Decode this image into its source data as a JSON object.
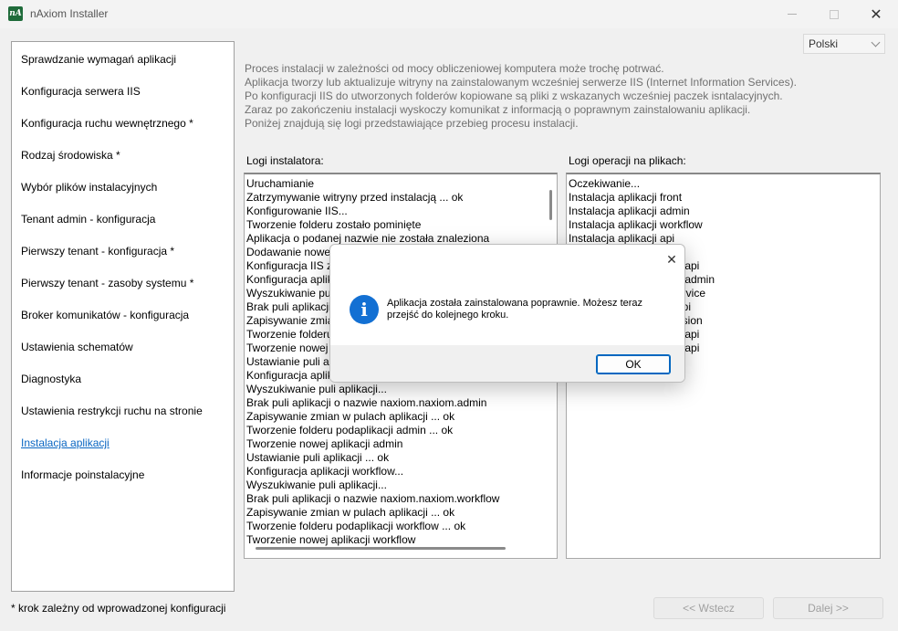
{
  "window": {
    "title": "nAxiom Installer",
    "icon_text": "nA",
    "close_glyph": "✕"
  },
  "sidebar": {
    "items": [
      {
        "label": "Sprawdzanie wymagań aplikacji"
      },
      {
        "label": "Konfiguracja serwera IIS"
      },
      {
        "label": "Konfiguracja ruchu wewnętrznego *"
      },
      {
        "label": "Rodzaj środowiska *"
      },
      {
        "label": "Wybór plików instalacyjnych"
      },
      {
        "label": "Tenant admin - konfiguracja"
      },
      {
        "label": "Pierwszy tenant - konfiguracja *"
      },
      {
        "label": "Pierwszy tenant - zasoby systemu *"
      },
      {
        "label": "Broker komunikatów - konfiguracja"
      },
      {
        "label": "Ustawienia schematów"
      },
      {
        "label": "Diagnostyka"
      },
      {
        "label": "Ustawienia restrykcji ruchu na stronie"
      },
      {
        "label": "Instalacja aplikacji"
      },
      {
        "label": "Informacje poinstalacyjne"
      }
    ],
    "active_index": 12
  },
  "footnote": "* krok zależny od wprowadzonej konfiguracji",
  "language": {
    "selected": "Polski"
  },
  "description": [
    "Proces instalacji w zależności od mocy obliczeniowej komputera może trochę potrwać.",
    "Aplikacja tworzy lub aktualizuje witryny na zainstalowanym wcześniej serwerze IIS (Internet Information Services).",
    "Po konfiguracji IIS do utworzonych folderów kopiowane są pliki z wskazanych wcześniej paczek isntalacyjnych.",
    "Zaraz po zakończeniu instalacji wyskoczy komunikat z informacją o poprawnym zainstalowaniu aplikacji.",
    "Poniżej znajdują się logi przedstawiające przebieg procesu instalacji."
  ],
  "installer_log": {
    "label": "Logi instalatora:",
    "lines": [
      "Uruchamianie",
      "Zatrzymywanie witryny przed instalacją ... ok",
      "Konfigurowanie IIS...",
      "Tworzenie folderu zostało pominięte",
      "Aplikacja o podanej nazwie nie została znaleziona",
      "Dodawanie nowej",
      "Konfiguracja IIS z",
      "Konfiguracja aplik",
      "Wyszukiwanie pul",
      "Brak puli aplikacji",
      "Zapisywanie zmian",
      "Tworzenie folderu",
      "Tworzenie nowej",
      "Ustawianie puli ap",
      "Konfiguracja aplik",
      "Wyszukiwanie puli aplikacji...",
      "Brak puli aplikacji o nazwie naxiom.naxiom.admin",
      "Zapisywanie zmian w pulach aplikacji ... ok",
      "Tworzenie folderu podaplikacji admin ... ok",
      "Tworzenie nowej aplikacji admin",
      "Ustawianie puli aplikacji ... ok",
      "Konfiguracja aplikacji workflow...",
      "Wyszukiwanie puli aplikacji...",
      "Brak puli aplikacji o nazwie naxiom.naxiom.workflow",
      "Zapisywanie zmian w pulach aplikacji ... ok",
      "Tworzenie folderu podaplikacji workflow ... ok",
      "Tworzenie nowej aplikacji workflow"
    ]
  },
  "file_log": {
    "label": "Logi operacji na plikach:",
    "lines": [
      "Oczekiwanie...",
      "Instalacja aplikacji front",
      "Instalacja aplikacji admin",
      "Instalacja aplikacji workflow",
      "Instalacja aplikacji api",
      "",
      "tsapi",
      "tsadmin",
      "ervice",
      "api",
      "usion",
      "tsapi",
      "leapi",
      "pi",
      "n"
    ]
  },
  "nav": {
    "back_label": "<< Wstecz",
    "next_label": "Dalej >>"
  },
  "dialog": {
    "message_line1": "Aplikacja została zainstalowana poprawnie. Możesz teraz",
    "message_line2": "przejść do kolejnego kroku.",
    "ok_label": "OK",
    "info_glyph": "i",
    "close_glyph": "✕"
  },
  "colors": {
    "accent": "#0067c0",
    "info_icon": "#1370d3",
    "active_link": "#0a66c2"
  }
}
